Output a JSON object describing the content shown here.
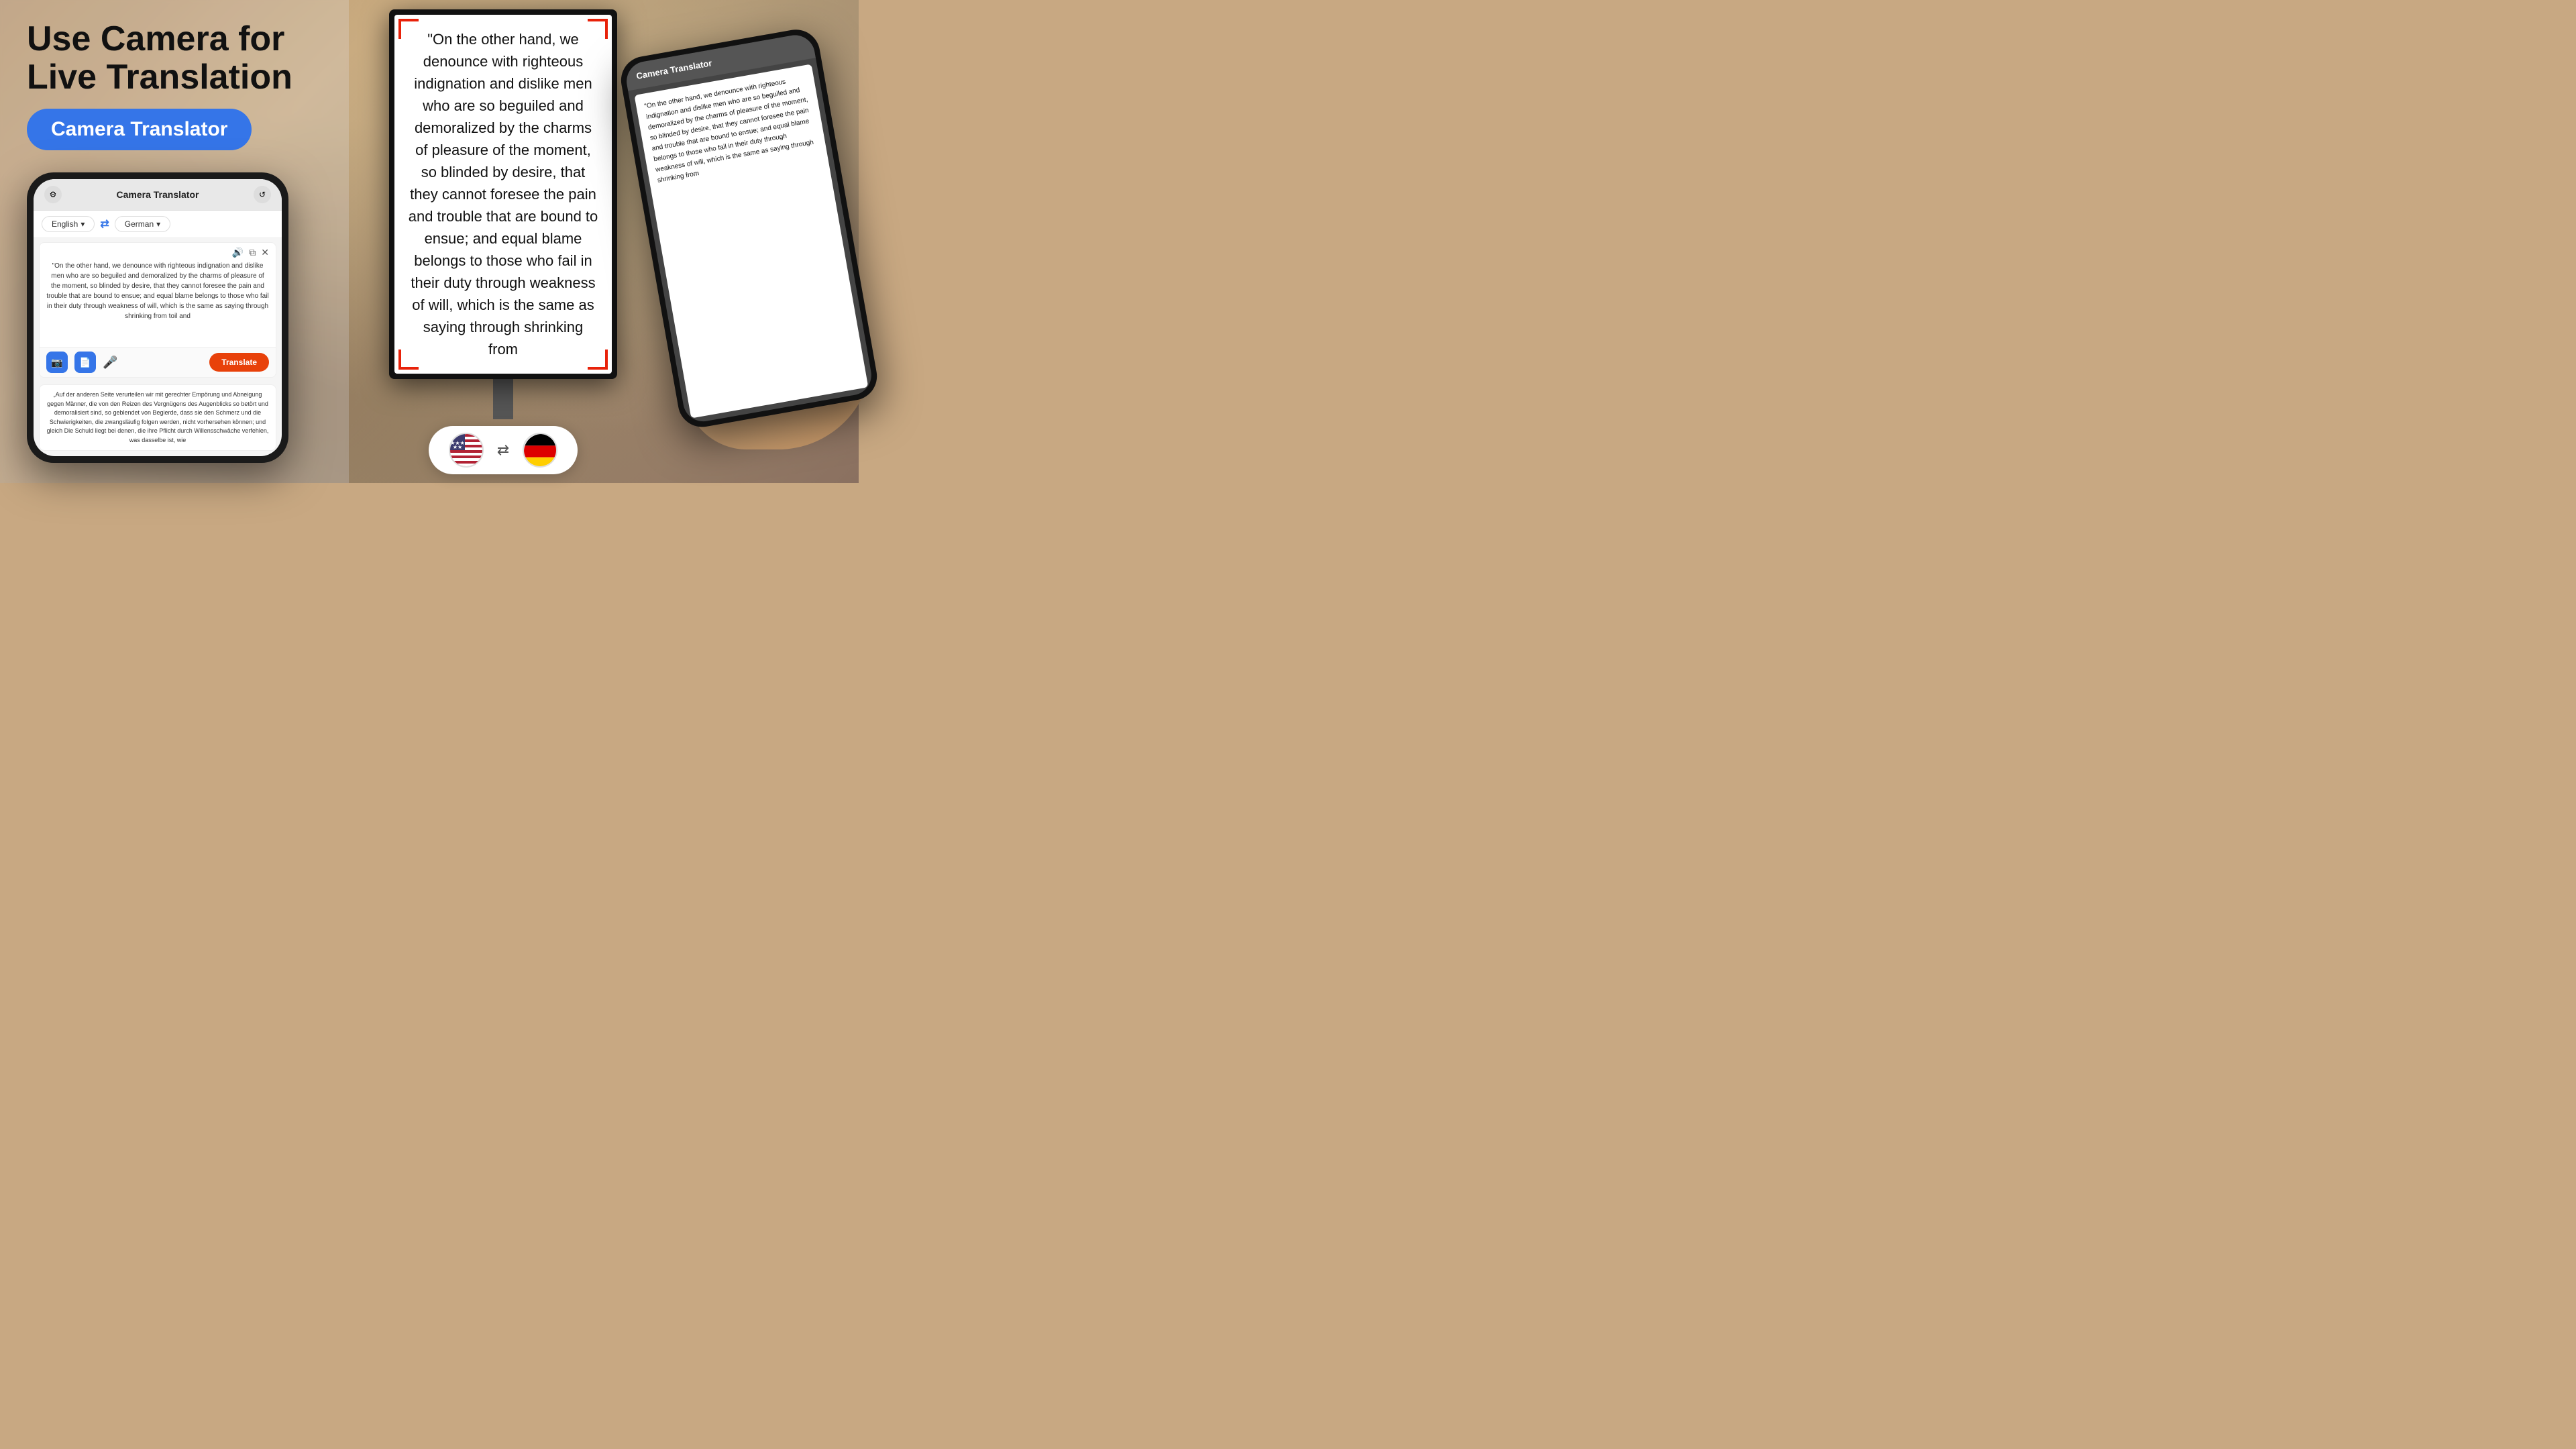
{
  "headline": {
    "line1": "Use Camera for",
    "line2": "Live Translation"
  },
  "app_badge": "Camera Translator",
  "phone": {
    "title": "Camera Translator",
    "source_lang": "English",
    "target_lang": "German",
    "input_text": "\"On the other hand, we denounce with righteous indignation and dislike men who are so beguiled and demoralized by the charms of pleasure of the moment, so blinded by desire, that they cannot foresee the pain and trouble that are bound to ensue; and equal blame belongs to those who fail in their duty through weakness of will, which is the same as saying through shrinking from toil and",
    "translated_text": "„Auf der anderen Seite verurteilen wir mit gerechter Empörung und Abneigung gegen Männer, die von den Reizen des Vergnügens des Augenblicks so betört und demoralisiert sind, so geblendet von Begierde, dass sie den Schmerz und die Schwierigkeiten, die zwangsläufig folgen werden, nicht vorhersehen können; und gleich Die Schuld liegt bei denen, die ihre Pflicht durch Willensschwäche verfehlen, was dasselbe ist, wie",
    "translate_btn": "Translate"
  },
  "billboard": {
    "text": "\"On the other hand, we denounce with righteous indignation and dislike men who are so beguiled and demoralized by the charms of pleasure of the moment, so blinded by desire, that they cannot foresee the pain and trouble that are bound to ensue; and equal blame belongs to those who fail in their duty through weakness of will, which is the same as saying through shrinking from"
  },
  "phone2": {
    "title": "Camera Translator",
    "screen_text": "\"On the other hand, we denounce with righteous indignation and dislike men who are so beguiled and demoralized by the charms of pleasure of the moment, so blinded by desire, that they cannot foresee the pain and trouble that are bound to ensue; and equal blame belongs to those who fail in their duty through weakness of will, which is the same as saying through shrinking from"
  },
  "flags": {
    "source": "US",
    "target": "Germany",
    "swap_symbol": "⇄"
  },
  "colors": {
    "blue": "#3575e8",
    "orange_red": "#e8410a",
    "dark": "#111111",
    "red_bracket": "#e8220a"
  }
}
